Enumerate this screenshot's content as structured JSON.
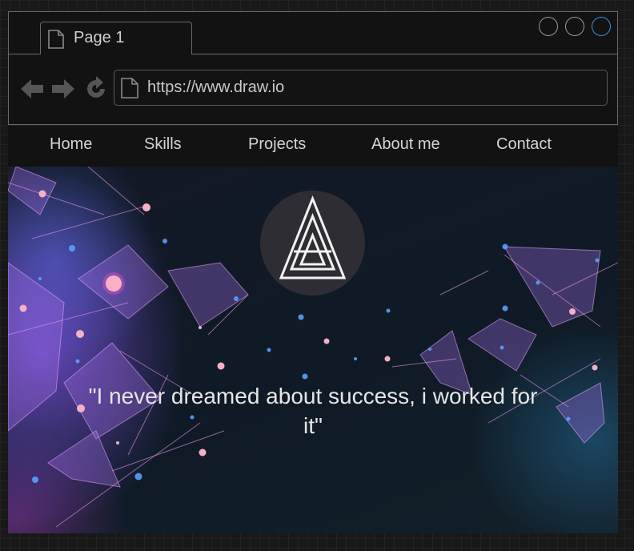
{
  "browser": {
    "tab_title": "Page 1",
    "url": "https://www.draw.io",
    "accent_color": "#3a8fd8"
  },
  "nav": {
    "items": [
      "Home",
      "Skills",
      "Projects",
      "About me",
      "Contact"
    ]
  },
  "hero": {
    "quote": "\"I never dreamed about success, i worked for it\""
  },
  "icons": {
    "page": "page-icon",
    "back": "back-arrow-icon",
    "forward": "forward-arrow-icon",
    "refresh": "refresh-icon",
    "logo": "triangle-logo-icon"
  }
}
